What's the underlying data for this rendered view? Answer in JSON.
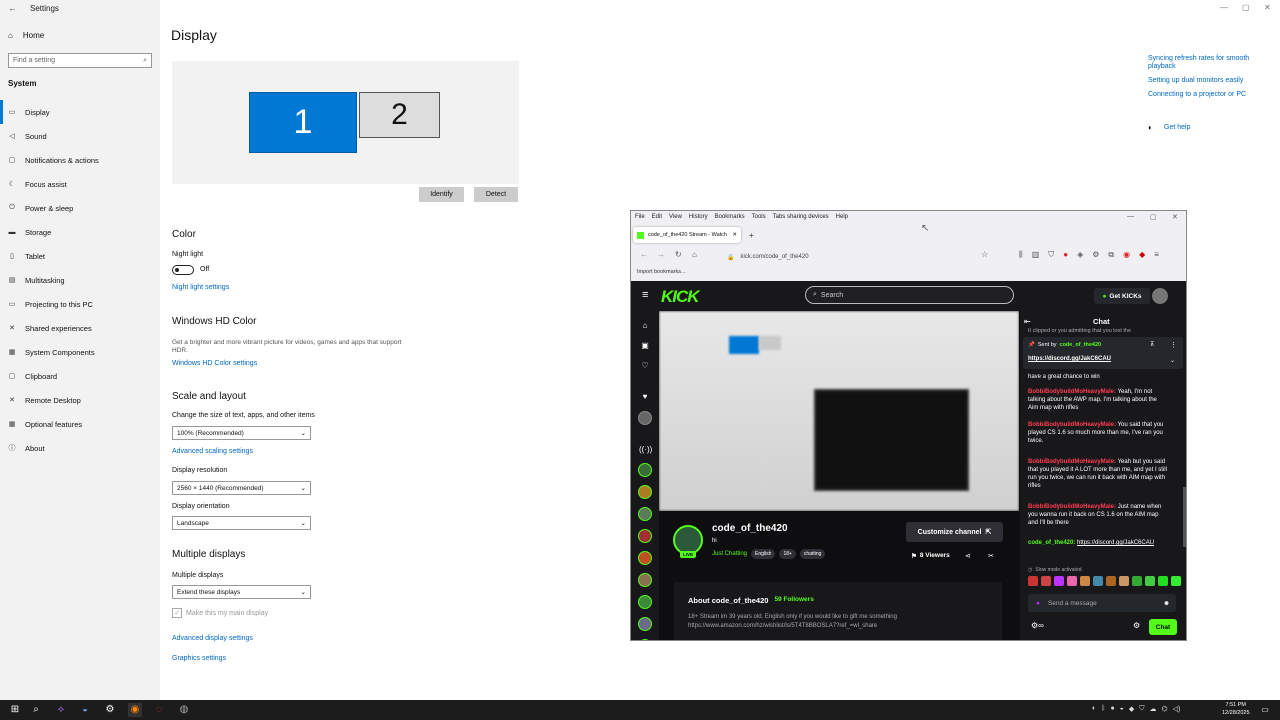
{
  "settings": {
    "window_title": "Settings",
    "home": "Home",
    "search_placeholder": "Find a setting",
    "category": "System",
    "nav": [
      {
        "label": "Display",
        "icon": "monitor-icon",
        "glyph": "▭"
      },
      {
        "label": "Sound",
        "icon": "speaker-icon",
        "glyph": "◁"
      },
      {
        "label": "Notifications & actions",
        "icon": "notification-icon",
        "glyph": "▢"
      },
      {
        "label": "Focus assist",
        "icon": "moon-icon",
        "glyph": "☾"
      },
      {
        "label": "Power & sleep",
        "icon": "power-icon",
        "glyph": "⏻"
      },
      {
        "label": "Storage",
        "icon": "storage-icon",
        "glyph": "▬"
      },
      {
        "label": "Tablet",
        "icon": "tablet-icon",
        "glyph": "▯"
      },
      {
        "label": "Multitasking",
        "icon": "multitask-icon",
        "glyph": "▤"
      },
      {
        "label": "Projecting to this PC",
        "icon": "project-icon",
        "glyph": "▭"
      },
      {
        "label": "Shared experiences",
        "icon": "share-icon",
        "glyph": "✕"
      },
      {
        "label": "System Components",
        "icon": "components-icon",
        "glyph": "▦"
      },
      {
        "label": "Clipboard",
        "icon": "clipboard-icon",
        "glyph": "▢"
      },
      {
        "label": "Remote Desktop",
        "icon": "remote-icon",
        "glyph": "✕"
      },
      {
        "label": "Optional features",
        "icon": "features-icon",
        "glyph": "▦"
      },
      {
        "label": "About",
        "icon": "info-icon",
        "glyph": "ⓘ"
      }
    ],
    "page_title": "Display",
    "monitor1": "1",
    "monitor2": "2",
    "identify": "Identify",
    "detect": "Detect",
    "color_heading": "Color",
    "night_light": "Night light",
    "night_light_state": "Off",
    "night_light_settings": "Night light settings",
    "hd_heading": "Windows HD Color",
    "hd_desc": "Get a brighter and more vibrant picture for videos, games and apps that support HDR.",
    "hd_link": "Windows HD Color settings",
    "scale_heading": "Scale and layout",
    "scale_label": "Change the size of text, apps, and other items",
    "scale_value": "100% (Recommended)",
    "adv_scaling": "Advanced scaling settings",
    "res_label": "Display resolution",
    "res_value": "2560 × 1440 (Recommended)",
    "orient_label": "Display orientation",
    "orient_value": "Landscape",
    "multi_heading": "Multiple displays",
    "multi_label": "Multiple displays",
    "multi_value": "Extend these displays",
    "main_display": "Make this my main display",
    "adv_display": "Advanced display settings",
    "graphics": "Graphics settings",
    "related": [
      "Syncing refresh rates for smooth playback",
      "Setting up dual monitors easily",
      "Connecting to a projector or PC"
    ],
    "get_help": "Get help"
  },
  "firefox": {
    "menu": [
      "File",
      "Edit",
      "View",
      "History",
      "Bookmarks",
      "Tools",
      "Tabs sharing devices",
      "Help"
    ],
    "tab_title": "code_of_the420 Stream - Watch",
    "url": "kick.com/code_of_the420",
    "import_bookmarks": "Import bookmarks...",
    "kick": {
      "logo": "KICK",
      "search": "Search",
      "get_kicks": "Get KICKs",
      "chat_title": "Chat",
      "pinned_label": "Sent by",
      "pinned_user": "code_of_the420",
      "pinned_link": "https://discord.gg/JakC6CAU",
      "top_clip": "It clipped or you admitting that you lost the",
      "messages": [
        {
          "user": "",
          "text": "have a great chance to win"
        },
        {
          "user": "BobbiBodybuildMoHeavyMale:",
          "text": "Yeah, I'm not talking about the AWP map, I'm talking about the Aim map with rifles"
        },
        {
          "user": "BobbiBodybuildMoHeavyMale:",
          "text": "You said that you played CS 1.6 so much more than me, I've ran you twice."
        },
        {
          "user": "BobbiBodybuildMoHeavyMale:",
          "text": "Yeah but you said that you played it A LOT more than me, and yet I still run you twice, we can run it back with AIM map with rifles"
        },
        {
          "user": "BobbiBodybuildMoHeavyMale:",
          "text": "Just name when you wanna run it back on CS 1.6 on the AIM map and I'll be there"
        }
      ],
      "last_user": "code_of_the420:",
      "last_link": "https://discord.gg/JakC6CAU",
      "slow_mode": "Slow mode activated",
      "send_placeholder": "Send a message",
      "chat_button": "Chat",
      "channel_name": "code_of_the420",
      "channel_title": "hi",
      "category": "Just Chatting",
      "tags": [
        "English",
        "18+",
        "chatting"
      ],
      "live": "LIVE",
      "customize": "Customize channel",
      "viewers": "8 Viewers",
      "about": "About code_of_the420",
      "followers": "59 Followers",
      "bio": "18+ Stream im 39 years old. English only if you would like to gift me something https://www.amazon.com/hz/wishlist/ls/5T4T8BBOSLA7?ref_=wl_share"
    }
  },
  "taskbar": {
    "time": "7:51 PM",
    "date": "12/28/2025"
  }
}
